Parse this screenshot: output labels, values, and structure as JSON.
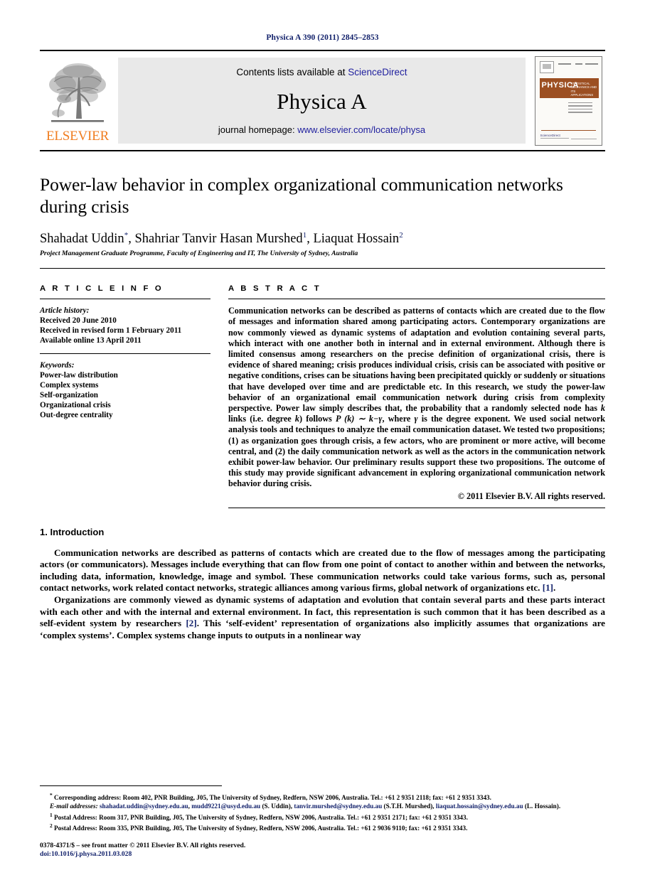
{
  "running_head": "Physica A 390 (2011) 2845–2853",
  "masthead": {
    "publisher_wordmark": "ELSEVIER",
    "contents_prefix": "Contents lists available at",
    "contents_link": "ScienceDirect",
    "journal_title": "Physica A",
    "homepage_prefix": "journal homepage:",
    "homepage_link": "www.elsevier.com/locate/physa",
    "cover": {
      "banner_title": "PHYSICA",
      "banner_letter": "A",
      "banner_subtitle": "STATISTICAL MECHANICS AND ITS APPLICATIONS",
      "sciencedirect_label": "ScienceDirect"
    }
  },
  "article": {
    "title": "Power-law behavior in complex organizational communication networks during crisis",
    "authors_html": "Shahadat Uddin*, Shahriar Tanvir Hasan Murshed¹, Liaquat Hossain²",
    "author_1": "Shahadat Uddin",
    "author_2": "Shahriar Tanvir Hasan Murshed",
    "author_3": "Liaquat Hossain",
    "affiliation": "Project Management Graduate Programme, Faculty of Engineering and IT, The University of Sydney, Australia"
  },
  "info": {
    "heading": "A R T I C L E   I N F O",
    "history_label": "Article history:",
    "history": [
      "Received 20 June 2010",
      "Received in revised form 1 February 2011",
      "Available online 13 April 2011"
    ],
    "keywords_label": "Keywords:",
    "keywords": [
      "Power-law distribution",
      "Complex systems",
      "Self-organization",
      "Organizational crisis",
      "Out-degree centrality"
    ]
  },
  "abstract": {
    "heading": "A B S T R A C T",
    "part1": "Communication networks can be described as patterns of contacts which are created due to the flow of messages and information shared among participating actors. Contemporary organizations are now commonly viewed as dynamic systems of adaptation and evolution containing several parts, which interact with one another both in internal and in external environment. Although there is limited consensus among researchers on the precise definition of organizational crisis, there is evidence of shared meaning; crisis produces individual crisis, crisis can be associated with positive or negative conditions, crises can be situations having been precipitated quickly or suddenly or situations that have developed over time and are predictable etc. In this research, we study the power-law behavior of an organizational email communication network during crisis from complexity perspective. Power law simply describes that, the probability that a randomly selected node has ",
    "math_k_links": "k",
    "part2": " links (i.e. degree ",
    "math_k2": "k",
    "part3": ") follows ",
    "formula": "P (k) ∼ k−γ",
    "part4": ", where ",
    "math_gamma": "γ",
    "part5": " is the degree exponent. We used social network analysis tools and techniques to analyze the email communication dataset. We tested two propositions; (1) as organization goes through crisis, a few actors, who are prominent or more active, will become central, and (2) the daily communication network as well as the actors in the communication network exhibit power-law behavior. Our preliminary results support these two propositions. The outcome of this study may provide significant advancement in exploring organizational communication network behavior during crisis.",
    "copyright": "© 2011 Elsevier B.V. All rights reserved."
  },
  "introduction": {
    "heading": "1.  Introduction",
    "paragraph_1_a": "Communication networks are described as patterns of contacts which are created due to the flow of messages among the participating actors (or communicators). Messages include everything that can flow from one point of contact to another within and between the networks, including data, information, knowledge, image and symbol. These communication networks could take various forms, such as, personal contact networks, work related contact networks, strategic alliances among various firms, global network of organizations etc. ",
    "paragraph_1_cite": "[1]",
    "paragraph_1_b": ".",
    "paragraph_2_a": "Organizations are commonly viewed as dynamic systems of adaptation and evolution that contain several parts and these parts interact with each other and with the internal and external environment. In fact, this representation is such common that it has been described as a self-evident system by researchers ",
    "paragraph_2_cite": "[2]",
    "paragraph_2_b": ". This ‘self-evident’ representation of organizations also implicitly assumes that organizations are ‘complex systems’. Complex systems change inputs to outputs in a nonlinear way"
  },
  "footnotes": {
    "corresponding_marker": "*",
    "corresponding": "Corresponding address: Room 402, PNR Building, J05, The University of Sydney, Redfern, NSW 2006, Australia. Tel.: +61 2 9351 2118; fax: +61 2 9351 3343.",
    "email_label": "E-mail addresses:",
    "email_1": "shahadat.uddin@sydney.edu.au",
    "email_2": "mudd9221@usyd.edu.au",
    "email_1_attrib": "(S. Uddin),",
    "email_3": "tanvir.murshed@sydney.edu.au",
    "email_3_attrib": "(S.T.H. Murshed),",
    "email_4": "liaquat.hossain@sydney.edu.au",
    "email_4_attrib": "(L. Hossain).",
    "note_1_marker": "1",
    "note_1": "Postal Address: Room 317, PNR Building, J05, The University of Sydney, Redfern, NSW 2006, Australia. Tel.: +61 2 9351 2171; fax: +61 2 9351 3343.",
    "note_2_marker": "2",
    "note_2": "Postal Address: Room 335, PNR Building, J05, The University of Sydney, Redfern, NSW 2006, Australia. Tel.: +61 2 9036 9110; fax: +61 2 9351 3343."
  },
  "imprint": {
    "issn_line": "0378-4371/$ – see front matter © 2011 Elsevier B.V. All rights reserved.",
    "doi_line": "doi:10.1016/j.physa.2011.03.028"
  },
  "colors": {
    "link_blue": "#12216b",
    "elsevier_orange": "#f07d20",
    "cover_brown": "#9c4f22",
    "masthead_gray": "#e9e9e9"
  }
}
